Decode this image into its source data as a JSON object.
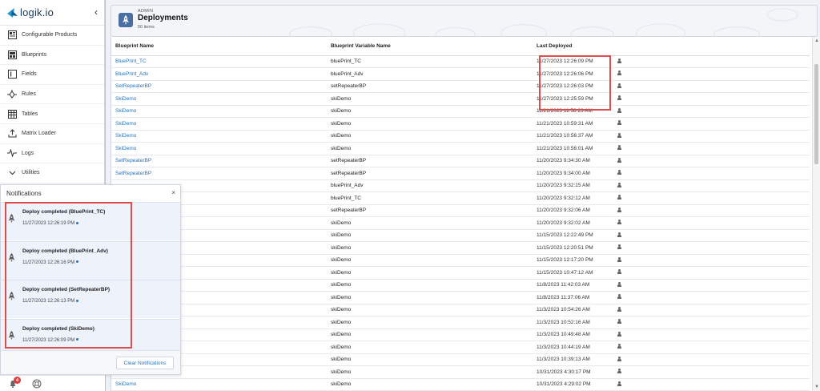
{
  "app": {
    "logo_text": "logik.io",
    "collapse_glyph": "‹"
  },
  "sidebar": {
    "items": [
      {
        "label": "Configurable Products",
        "icon": "configurable-products-icon"
      },
      {
        "label": "Blueprints",
        "icon": "blueprints-icon"
      },
      {
        "label": "Fields",
        "icon": "fields-icon"
      },
      {
        "label": "Rules",
        "icon": "rules-icon"
      },
      {
        "label": "Tables",
        "icon": "tables-icon"
      },
      {
        "label": "Matrix Loader",
        "icon": "matrix-loader-icon"
      },
      {
        "label": "Logs",
        "icon": "logs-icon"
      },
      {
        "label": "Utilities",
        "icon": "chevron-down-icon"
      }
    ]
  },
  "header": {
    "sup": "ADMIN",
    "title": "Deployments",
    "count": "50 items"
  },
  "table": {
    "columns": [
      "Blueprint Name",
      "Blueprint Variable Name",
      "Last Deployed"
    ],
    "rows": [
      [
        "BluePrint_TC",
        "bluePrint_TC",
        "11/27/2023 12:26:09 PM"
      ],
      [
        "BluePrint_Adv",
        "bluePrint_Adv",
        "11/27/2023 12:26:06 PM"
      ],
      [
        "SetRepeaterBP",
        "setRepeaterBP",
        "11/27/2023 12:26:03 PM"
      ],
      [
        "SkiDemo",
        "skiDemo",
        "11/27/2023 12:25:59 PM"
      ],
      [
        "SkiDemo",
        "skiDemo",
        "11/21/2023 11:58:23 AM"
      ],
      [
        "SkiDemo",
        "skiDemo",
        "11/21/2023 10:59:31 AM"
      ],
      [
        "SkiDemo",
        "skiDemo",
        "11/21/2023 10:56:37 AM"
      ],
      [
        "SkiDemo",
        "skiDemo",
        "11/21/2023 10:56:01 AM"
      ],
      [
        "SetRepeaterBP",
        "setRepeaterBP",
        "11/20/2023 9:34:30 AM"
      ],
      [
        "SetRepeaterBP",
        "setRepeaterBP",
        "11/20/2023 9:34:00 AM"
      ],
      [
        "",
        "bluePrint_Adv",
        "11/20/2023 9:32:15 AM"
      ],
      [
        "",
        "bluePrint_TC",
        "11/20/2023 9:32:12 AM"
      ],
      [
        "",
        "setRepeaterBP",
        "11/20/2023 9:32:06 AM"
      ],
      [
        "",
        "skiDemo",
        "11/20/2023 9:32:02 AM"
      ],
      [
        "",
        "skiDemo",
        "11/15/2023 12:22:49 PM"
      ],
      [
        "",
        "skiDemo",
        "11/15/2023 12:20:51 PM"
      ],
      [
        "",
        "skiDemo",
        "11/15/2023 12:17:20 PM"
      ],
      [
        "",
        "skiDemo",
        "11/15/2023 10:47:12 AM"
      ],
      [
        "",
        "skiDemo",
        "11/8/2023 11:42:03 AM"
      ],
      [
        "",
        "skiDemo",
        "11/8/2023 11:37:06 AM"
      ],
      [
        "",
        "skiDemo",
        "11/3/2023 10:54:26 AM"
      ],
      [
        "",
        "skiDemo",
        "11/3/2023 10:52:16 AM"
      ],
      [
        "",
        "skiDemo",
        "11/3/2023 10:49:48 AM"
      ],
      [
        "",
        "skiDemo",
        "11/3/2023 10:44:19 AM"
      ],
      [
        "",
        "skiDemo",
        "11/3/2023 10:39:13 AM"
      ],
      [
        "",
        "skiDemo",
        "10/31/2023 4:30:17 PM"
      ],
      [
        "SkiDemo",
        "skiDemo",
        "10/31/2023 4:29:02 PM"
      ]
    ]
  },
  "notifications": {
    "title": "Notifications",
    "close_glyph": "×",
    "items": [
      {
        "title": "Deploy completed (BluePrint_TC)",
        "time": "11/27/2023 12:26:19 PM"
      },
      {
        "title": "Deploy completed (BluePrint_Adv)",
        "time": "11/27/2023 12:26:16 PM"
      },
      {
        "title": "Deploy completed (SetRepeaterBP)",
        "time": "11/27/2023 12:26:13 PM"
      },
      {
        "title": "Deploy completed (SkiDemo)",
        "time": "11/27/2023 12:26:09 PM"
      }
    ],
    "clear_label": "Clear Notifications"
  },
  "dock": {
    "badge_count": "4"
  },
  "colors": {
    "link": "#2474c2",
    "highlight": "#e04b4b",
    "brand": "#1b3a5c"
  }
}
